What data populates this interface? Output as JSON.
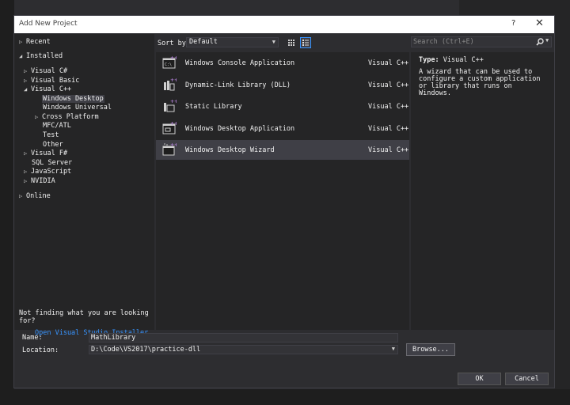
{
  "window": {
    "title": "Add New Project",
    "help": "?",
    "close": "✕"
  },
  "tree": {
    "recent": "Recent",
    "installed": "Installed",
    "visual_csharp": "Visual C#",
    "visual_basic": "Visual Basic",
    "visual_cpp": "Visual C++",
    "windows_desktop": "Windows Desktop",
    "windows_universal": "Windows Universal",
    "cross_platform": "Cross Platform",
    "mfc_atl": "MFC/ATL",
    "test": "Test",
    "other": "Other",
    "visual_fsharp": "Visual F#",
    "sql_server": "SQL Server",
    "javascript": "JavaScript",
    "nvidia": "NVIDIA",
    "online": "Online"
  },
  "footer_left": {
    "question": "Not finding what you are looking for?",
    "link": "Open Visual Studio Installer"
  },
  "sort": {
    "label": "Sort by:",
    "value": "Default"
  },
  "search": {
    "placeholder": "Search (Ctrl+E)"
  },
  "templates": [
    {
      "name": "Windows Console Application",
      "lang": "Visual C++",
      "icon": "console-app-icon"
    },
    {
      "name": "Dynamic-Link Library (DLL)",
      "lang": "Visual C++",
      "icon": "dll-icon"
    },
    {
      "name": "Static Library",
      "lang": "Visual C++",
      "icon": "static-library-icon"
    },
    {
      "name": "Windows Desktop Application",
      "lang": "Visual C++",
      "icon": "desktop-app-icon"
    },
    {
      "name": "Windows Desktop Wizard",
      "lang": "Visual C++",
      "icon": "desktop-wizard-icon"
    }
  ],
  "description": {
    "type_label": "Type:",
    "type_value": "Visual C++",
    "text": "A wizard that can be used to configure a custom application or library that runs on Windows."
  },
  "form": {
    "name_label": "Name:",
    "name_value": "MathLibrary",
    "location_label": "Location:",
    "location_value": "D:\\Code\\VS2017\\practice-dll",
    "browse": "Browse..."
  },
  "buttons": {
    "ok": "OK",
    "cancel": "Cancel"
  },
  "colors": {
    "accent": "#3794ff",
    "selected_row": "#3f3f46",
    "panel": "#252526",
    "icon_purple": "#b180d7"
  }
}
